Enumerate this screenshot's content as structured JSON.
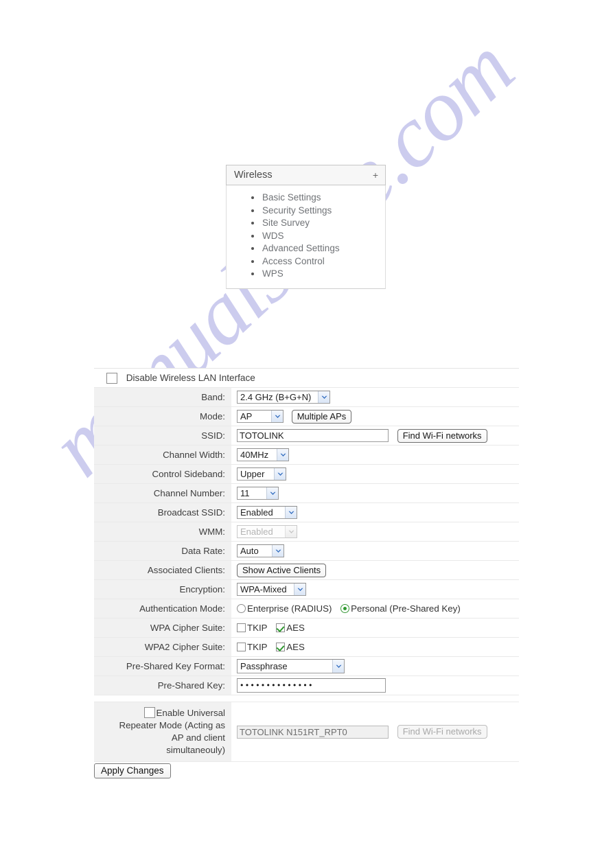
{
  "nav": {
    "title": "Wireless",
    "expand_icon": "+",
    "items": [
      {
        "label": "Basic Settings"
      },
      {
        "label": "Security Settings"
      },
      {
        "label": "Site Survey"
      },
      {
        "label": "WDS"
      },
      {
        "label": "Advanced Settings"
      },
      {
        "label": "Access Control"
      },
      {
        "label": "WPS"
      }
    ]
  },
  "form": {
    "disable_wlan_label": "Disable Wireless LAN Interface",
    "disable_wlan_checked": false,
    "rows": {
      "band": {
        "label": "Band:",
        "value": "2.4 GHz (B+G+N)"
      },
      "mode": {
        "label": "Mode:",
        "value": "AP",
        "button": "Multiple APs"
      },
      "ssid": {
        "label": "SSID:",
        "value": "TOTOLINK",
        "button": "Find Wi-Fi networks"
      },
      "channel_width": {
        "label": "Channel Width:",
        "value": "40MHz"
      },
      "control_sideband": {
        "label": "Control Sideband:",
        "value": "Upper"
      },
      "channel_number": {
        "label": "Channel Number:",
        "value": "11"
      },
      "broadcast_ssid": {
        "label": "Broadcast SSID:",
        "value": "Enabled"
      },
      "wmm": {
        "label": "WMM:",
        "value": "Enabled",
        "disabled": true
      },
      "data_rate": {
        "label": "Data Rate:",
        "value": "Auto"
      },
      "associated_clients": {
        "label": "Associated Clients:",
        "button": "Show Active Clients"
      },
      "encryption": {
        "label": "Encryption:",
        "value": "WPA-Mixed"
      },
      "auth_mode": {
        "label": "Authentication Mode:",
        "options": [
          {
            "label": "Enterprise (RADIUS)",
            "selected": false
          },
          {
            "label": "Personal (Pre-Shared Key)",
            "selected": true
          }
        ]
      },
      "wpa_cipher": {
        "label": "WPA Cipher Suite:",
        "options": [
          {
            "label": "TKIP",
            "checked": false
          },
          {
            "label": "AES",
            "checked": true
          }
        ]
      },
      "wpa2_cipher": {
        "label": "WPA2 Cipher Suite:",
        "options": [
          {
            "label": "TKIP",
            "checked": false
          },
          {
            "label": "AES",
            "checked": true
          }
        ]
      },
      "psk_format": {
        "label": "Pre-Shared Key Format:",
        "value": "Passphrase"
      },
      "psk": {
        "label": "Pre-Shared Key:",
        "value": "••••••••••••••"
      },
      "repeater": {
        "checkbox_label_line1": "Enable Universal",
        "checkbox_label_line2": "Repeater Mode (Acting as",
        "checkbox_label_line3": "AP and client",
        "checkbox_label_line4": "simultaneouly)",
        "checked": false,
        "value": "TOTOLINK N151RT_RPT0",
        "button": "Find Wi-Fi networks",
        "disabled": true
      }
    },
    "apply_button": "Apply Changes"
  },
  "watermark": {
    "text": "manualshive.com"
  }
}
